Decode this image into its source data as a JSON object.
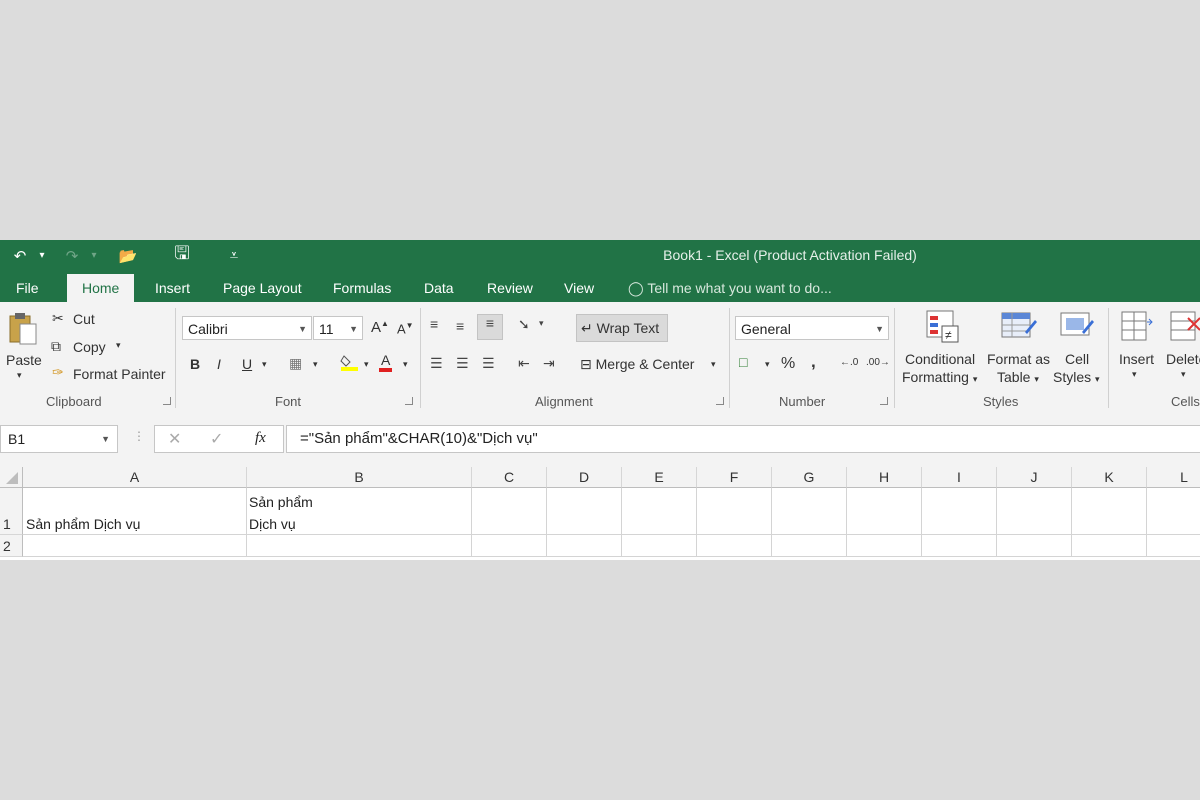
{
  "window": {
    "title": "Book1 - Excel (Product Activation Failed)"
  },
  "qat": {
    "undo": "↶",
    "dropdown": "▾",
    "redo": "↷",
    "open": "📂",
    "save": "🖫",
    "customize": "⩡"
  },
  "tabs": [
    "File",
    "Home",
    "Insert",
    "Page Layout",
    "Formulas",
    "Data",
    "Review",
    "View"
  ],
  "tell_me": "Tell me what you want to do...",
  "ribbon": {
    "clipboard": {
      "paste": "Paste",
      "cut": "Cut",
      "copy": "Copy",
      "format_painter": "Format Painter",
      "label": "Clipboard"
    },
    "font": {
      "name": "Calibri",
      "size": "11",
      "label": "Font",
      "bold": "B",
      "italic": "I",
      "underline": "U",
      "grow": "A",
      "shrink": "A"
    },
    "alignment": {
      "wrap_text": "Wrap Text",
      "merge_center": "Merge & Center",
      "label": "Alignment"
    },
    "number": {
      "format": "General",
      "percent": "%",
      "comma": ",",
      "label": "Number"
    },
    "styles": {
      "conditional_1": "Conditional",
      "conditional_2": "Formatting",
      "format_table_1": "Format as",
      "format_table_2": "Table",
      "cell_styles_1": "Cell",
      "cell_styles_2": "Styles",
      "label": "Styles"
    },
    "cells": {
      "insert": "Insert",
      "delete": "Delete",
      "label": "Cells"
    }
  },
  "formula_bar": {
    "name_box": "B1",
    "fx": "fx",
    "formula": "=\"Sản phẩm\"&CHAR(10)&\"Dịch vụ\""
  },
  "grid": {
    "columns": [
      "A",
      "B",
      "C",
      "D",
      "E",
      "F",
      "G",
      "H",
      "I",
      "J",
      "K",
      "L"
    ],
    "rows": [
      "1",
      "2"
    ],
    "cells": {
      "A1": "Sản phẩm Dịch vụ",
      "B1_line1": "Sản phẩm",
      "B1_line2": "Dịch vụ"
    }
  },
  "colors": {
    "excel_green": "#217346",
    "ribbon_bg": "#f3f3f3",
    "page_bg": "#dcdcdc"
  }
}
